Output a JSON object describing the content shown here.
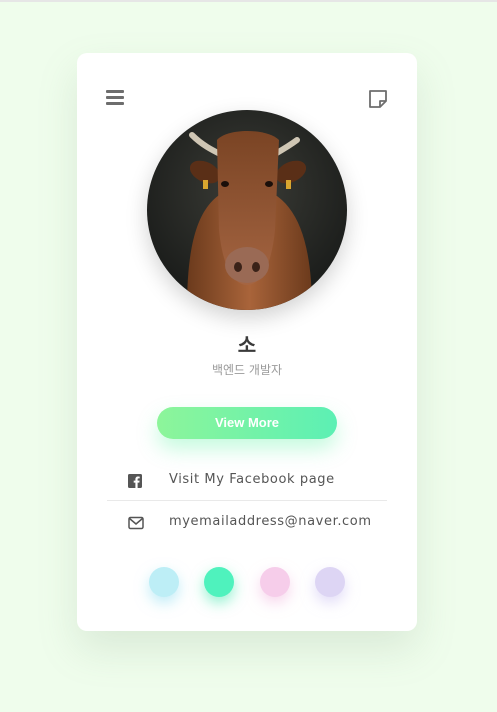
{
  "card": {
    "name": "소",
    "role": "백엔드 개발자",
    "button_label": "View More",
    "links": [
      {
        "icon": "facebook-icon",
        "label": "Visit My Facebook page"
      },
      {
        "icon": "envelope-icon",
        "label": "myemailaddress@naver.com"
      }
    ],
    "header": {
      "left_icon": "menu-icon",
      "right_icon": "note-icon"
    },
    "color_dots": [
      "#bdeef6",
      "#4ff2bd",
      "#f6cdea",
      "#ddd5f4"
    ]
  },
  "colors": {
    "background": "#effdec",
    "button_gradient": [
      "#8df59a",
      "#5cf0b4"
    ]
  }
}
